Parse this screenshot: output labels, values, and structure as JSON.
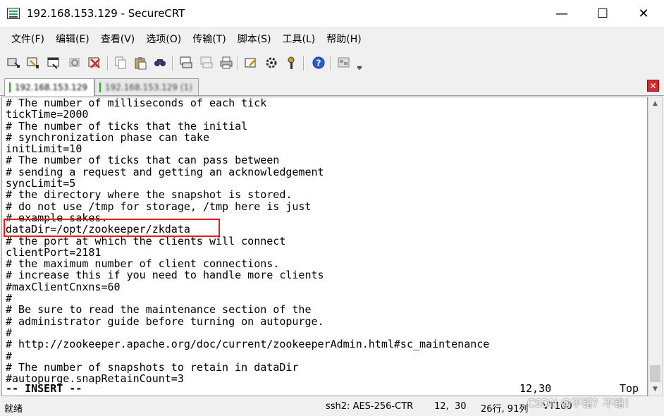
{
  "window": {
    "title": "192.168.153.129 - SecureCRT",
    "minimize_glyph": "—",
    "maximize_glyph": "☐",
    "close_glyph": "✕"
  },
  "menu": [
    "文件(F)",
    "编辑(E)",
    "查看(V)",
    "选项(O)",
    "传输(T)",
    "脚本(S)",
    "工具(L)",
    "帮助(H)"
  ],
  "tabs": [
    {
      "label": "192.168.153.129",
      "active": true
    },
    {
      "label": "192.168.153.129 (1)",
      "active": false
    }
  ],
  "terminal": {
    "lines": [
      "# The number of milliseconds of each tick",
      "tickTime=2000",
      "# The number of ticks that the initial",
      "# synchronization phase can take",
      "initLimit=10",
      "# The number of ticks that can pass between",
      "# sending a request and getting an acknowledgement",
      "syncLimit=5",
      "# the directory where the snapshot is stored.",
      "# do not use /tmp for storage, /tmp here is just",
      "# example sakes.",
      "dataDir=/opt/zookeeper/zkdata",
      "# the port at which the clients will connect",
      "clientPort=2181",
      "# the maximum number of client connections.",
      "# increase this if you need to handle more clients",
      "#maxClientCnxns=60",
      "#",
      "# Be sure to read the maintenance section of the",
      "# administrator guide before turning on autopurge.",
      "#",
      "# http://zookeeper.apache.org/doc/current/zookeeperAdmin.html#sc_maintenance",
      "#",
      "# The number of snapshots to retain in dataDir",
      "#autopurge.snapRetainCount=3"
    ],
    "mode": "-- INSERT --",
    "cursor_pos": "12,30",
    "scroll_pos": "Top",
    "highlight_color": "#e02020"
  },
  "statusbar": {
    "ready": "就绪",
    "cipher": "ssh2: AES-256-CTR",
    "cursor": "12,  30",
    "size": "26行, 91列",
    "term_type": "VT100"
  },
  "watermark": "CSDN @不错？不错！"
}
